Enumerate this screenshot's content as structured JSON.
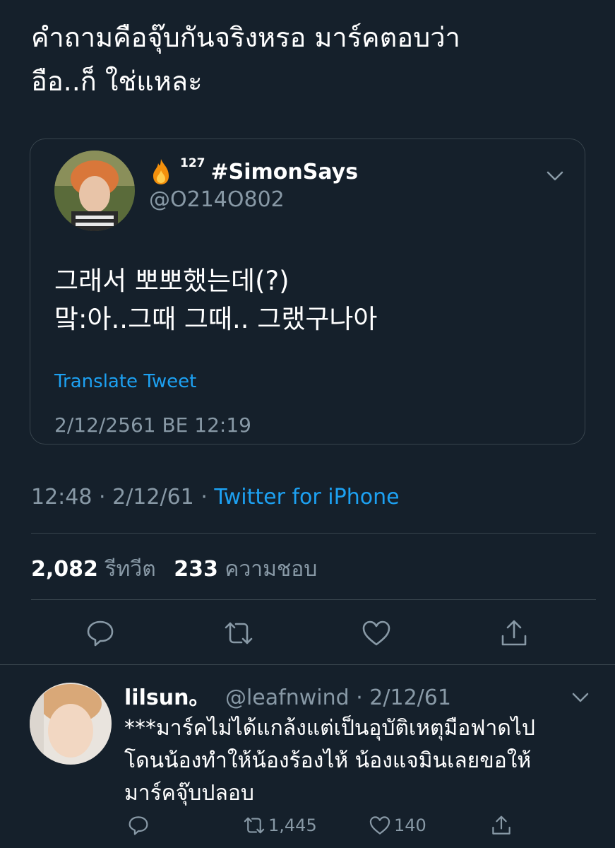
{
  "tweet": {
    "text_lines": [
      "คำถามคือจุ๊บกันจริงหรอ มาร์คตอบว่า",
      "อือ..ก็ ใช่แหละ"
    ],
    "time": "12:48",
    "separator": "·",
    "date": "2/12/61",
    "source": "Twitter for iPhone",
    "retweet_count": "2,082",
    "retweet_label": "รีทวีต",
    "like_count": "233",
    "like_label": "ความชอบ"
  },
  "quote": {
    "name_superscript": "127",
    "name": "#SimonSays",
    "handle": "@O214O802",
    "body_lines": [
      "그래서 뽀뽀했는데(?)",
      "맠:아..그때 그때.. 그랬구나아"
    ],
    "translate_label": "Translate Tweet",
    "timestamp": "2/12/2561 BE 12:19"
  },
  "actions": {
    "reply_icon": "comment-icon",
    "retweet_icon": "retweet-icon",
    "like_icon": "heart-icon",
    "share_icon": "share-icon"
  },
  "reply": {
    "name": "lilsun。",
    "handle": "@leafnwind",
    "separator": "·",
    "date": "2/12/61",
    "body_lines": [
      "***มาร์คไม่ได้แกล้งแต่เป็นอุบัติเหตุมือฟาดไป",
      "โดนน้องทำให้น้องร้องไห้ น้องแจมินเลยขอให้",
      "มาร์คจุ๊บปลอบ"
    ],
    "retweet_count": "1,445",
    "like_count": "140"
  },
  "colors": {
    "background": "#15202b",
    "accent": "#1da1f2",
    "secondary_text": "#8899a6",
    "border": "#38444d"
  }
}
